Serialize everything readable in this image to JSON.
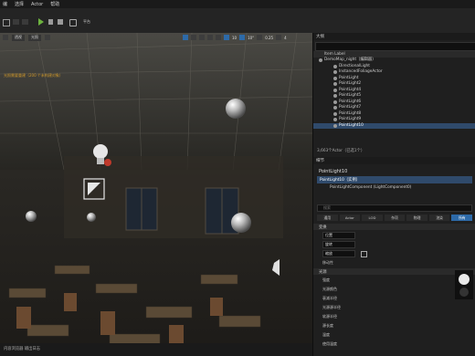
{
  "menu": [
    "编",
    "选择",
    "Actor",
    "帮助"
  ],
  "toolbar": {
    "platforms_label": "平台",
    "viewport_mode_label": "透视",
    "lit_label": "光照",
    "grid_snap_value": "10",
    "rotation_snap_value": "10°",
    "scale_snap_value": "0.25",
    "camera_speed_value": "4"
  },
  "outliner": {
    "tab_label": "大纲",
    "header_label": "Item Label",
    "items": [
      "DemoMap_night（编辑器）",
      "DirectionalLight",
      "InstancedFoliageActor",
      "PointLight",
      "PointLight2",
      "PointLight4",
      "PointLight5",
      "PointLight6",
      "PointLight7",
      "PointLight8",
      "PointLight9",
      "PointLight10"
    ],
    "selected_index": 11,
    "count_text": "3,663个Actor（已选1个）"
  },
  "details": {
    "tab_label": "细节",
    "actor_name": "PointLight10",
    "instance_label": "PointLight10（实例）",
    "component_label": "PointLightComponent (LightComponent0)",
    "search_placeholder": "搜索",
    "filter_tabs": [
      "通用",
      "Actor",
      "LOD",
      "杂项",
      "物理",
      "渲染",
      "所有"
    ],
    "active_tab_index": 6,
    "section_transform": "变换",
    "transform_rows": [
      "位置",
      "旋转",
      "缩放"
    ],
    "mobility_label": "移动性",
    "section_light": "光源",
    "light_rows": [
      "强度",
      "光源颜色",
      "衰减半径",
      "光源源半径",
      "软源半径",
      "源长度",
      "温度",
      "使用温度"
    ]
  },
  "status": {
    "left_text": "内容浏览器  输出日志"
  },
  "viewport_warning": "光照需要重建（200 个未构建对象）"
}
